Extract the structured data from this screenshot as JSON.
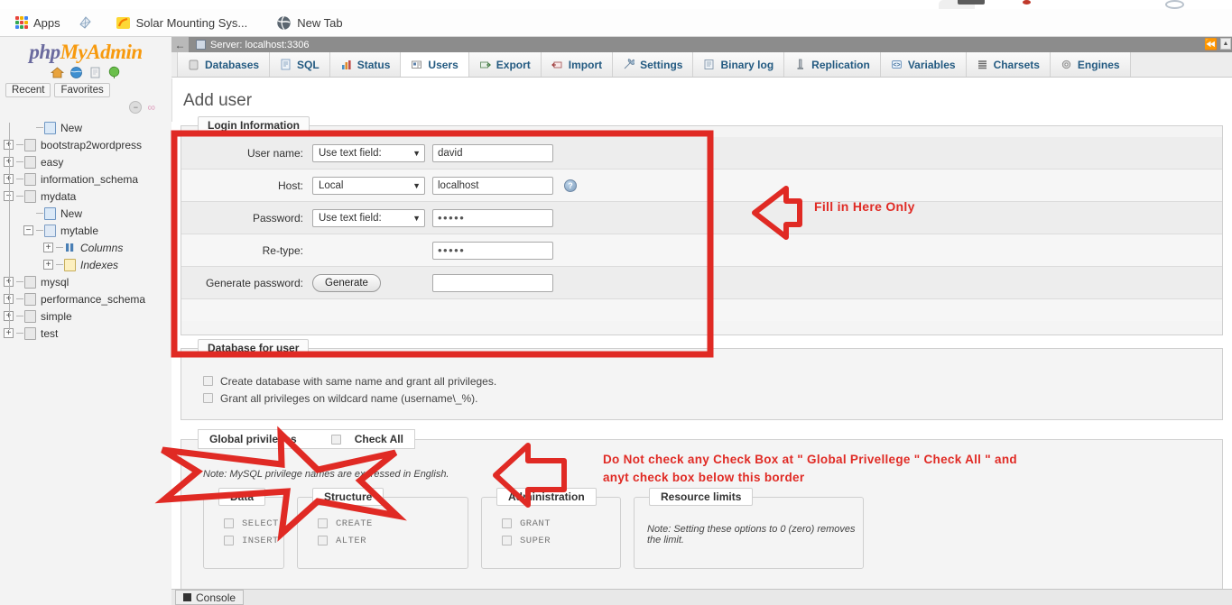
{
  "browser": {
    "bookmarks": [
      {
        "label": "Apps",
        "icon": "apps-grid-icon"
      },
      {
        "label": "",
        "icon": "bookmark-kite-icon"
      },
      {
        "label": "Solar Mounting Sys...",
        "icon": "solar-site-icon"
      },
      {
        "label": "New Tab",
        "icon": "globe-icon"
      }
    ]
  },
  "nav": {
    "logo_part1": "php",
    "logo_part2": "MyAdmin",
    "icons": [
      "home-icon",
      "globe-icon",
      "doc-icon",
      "balloon-icon"
    ],
    "quick": [
      {
        "label": "Recent"
      },
      {
        "label": "Favorites"
      }
    ],
    "collapse": {
      "minus": "−",
      "link": "∞"
    },
    "tree": [
      {
        "label": "New",
        "depth": 1,
        "toggle": "none",
        "icon": "new-db-icon",
        "italic": false
      },
      {
        "label": "bootstrap2wordpress",
        "depth": 0,
        "toggle": "plus",
        "icon": "db-icon",
        "italic": false
      },
      {
        "label": "easy",
        "depth": 0,
        "toggle": "plus",
        "icon": "db-icon",
        "italic": false
      },
      {
        "label": "information_schema",
        "depth": 0,
        "toggle": "plus",
        "icon": "db-icon",
        "italic": false
      },
      {
        "label": "mydata",
        "depth": 0,
        "toggle": "minus",
        "icon": "db-icon",
        "italic": false
      },
      {
        "label": "New",
        "depth": 1,
        "toggle": "none",
        "icon": "new-db-icon",
        "italic": false
      },
      {
        "label": "mytable",
        "depth": 1,
        "toggle": "minus",
        "icon": "table-icon",
        "italic": false
      },
      {
        "label": "Columns",
        "depth": 2,
        "toggle": "plus",
        "icon": "columns-icon",
        "italic": true
      },
      {
        "label": "Indexes",
        "depth": 2,
        "toggle": "plus",
        "icon": "indexes-icon",
        "italic": true
      },
      {
        "label": "mysql",
        "depth": 0,
        "toggle": "plus",
        "icon": "db-icon",
        "italic": false
      },
      {
        "label": "performance_schema",
        "depth": 0,
        "toggle": "plus",
        "icon": "db-icon",
        "italic": false
      },
      {
        "label": "simple",
        "depth": 0,
        "toggle": "plus",
        "icon": "db-icon",
        "italic": false
      },
      {
        "label": "test",
        "depth": 0,
        "toggle": "plus",
        "icon": "db-icon",
        "italic": false
      }
    ]
  },
  "server_bar": {
    "back_glyph": "←",
    "label": "Server: localhost:3306",
    "collapse_glyph": "⏪"
  },
  "tabs": [
    {
      "label": "Databases",
      "icon": "database-icon",
      "active": false
    },
    {
      "label": "SQL",
      "icon": "sql-icon",
      "active": false
    },
    {
      "label": "Status",
      "icon": "status-icon",
      "active": false
    },
    {
      "label": "Users",
      "icon": "users-icon",
      "active": true
    },
    {
      "label": "Export",
      "icon": "export-icon",
      "active": false
    },
    {
      "label": "Import",
      "icon": "import-icon",
      "active": false
    },
    {
      "label": "Settings",
      "icon": "wrench-icon",
      "active": false
    },
    {
      "label": "Binary log",
      "icon": "binarylog-icon",
      "active": false
    },
    {
      "label": "Replication",
      "icon": "replication-icon",
      "active": false
    },
    {
      "label": "Variables",
      "icon": "variables-icon",
      "active": false
    },
    {
      "label": "Charsets",
      "icon": "charsets-icon",
      "active": false
    },
    {
      "label": "Engines",
      "icon": "engines-icon",
      "active": false
    }
  ],
  "page": {
    "title": "Add user"
  },
  "login_information": {
    "legend": "Login Information",
    "rows": {
      "username": {
        "label": "User name:",
        "select_value": "Use text field:",
        "text_value": "david"
      },
      "host": {
        "label": "Host:",
        "select_value": "Local",
        "text_value": "localhost",
        "help_icon": "help-info-icon"
      },
      "password": {
        "label": "Password:",
        "select_value": "Use text field:",
        "text_value": "•••••"
      },
      "retype": {
        "label": "Re-type:",
        "text_value": "•••••"
      },
      "generate": {
        "label": "Generate password:",
        "button_label": "Generate",
        "text_value": ""
      }
    }
  },
  "database_for_user": {
    "legend": "Database for user",
    "options": [
      {
        "label": "Create database with same name and grant all privileges.",
        "checked": false
      },
      {
        "label": "Grant all privileges on wildcard name (username\\_%).",
        "checked": false
      }
    ]
  },
  "global_privileges": {
    "legend": "Global privileges",
    "check_all_label": "Check All",
    "check_all_checked": false,
    "note": "Note: MySQL privilege names are expressed in English.",
    "groups": [
      {
        "legend": "Data",
        "items": [
          "SELECT",
          "INSERT"
        ]
      },
      {
        "legend": "Structure",
        "items": [
          "CREATE",
          "ALTER"
        ]
      },
      {
        "legend": "Administration",
        "items": [
          "GRANT",
          "SUPER"
        ]
      }
    ],
    "resource_limits": {
      "legend": "Resource limits",
      "note": "Note: Setting these options to 0 (zero) removes the limit."
    }
  },
  "annotations": {
    "accent_color": "#e02a24",
    "fill_here": "Fill in Here Only",
    "do_not_check_line1": "Do Not check any Check Box  at  \" Global Privellege \" Check All \" and",
    "do_not_check_line2": "anyt check box  below this border"
  },
  "console": {
    "label": "Console"
  }
}
